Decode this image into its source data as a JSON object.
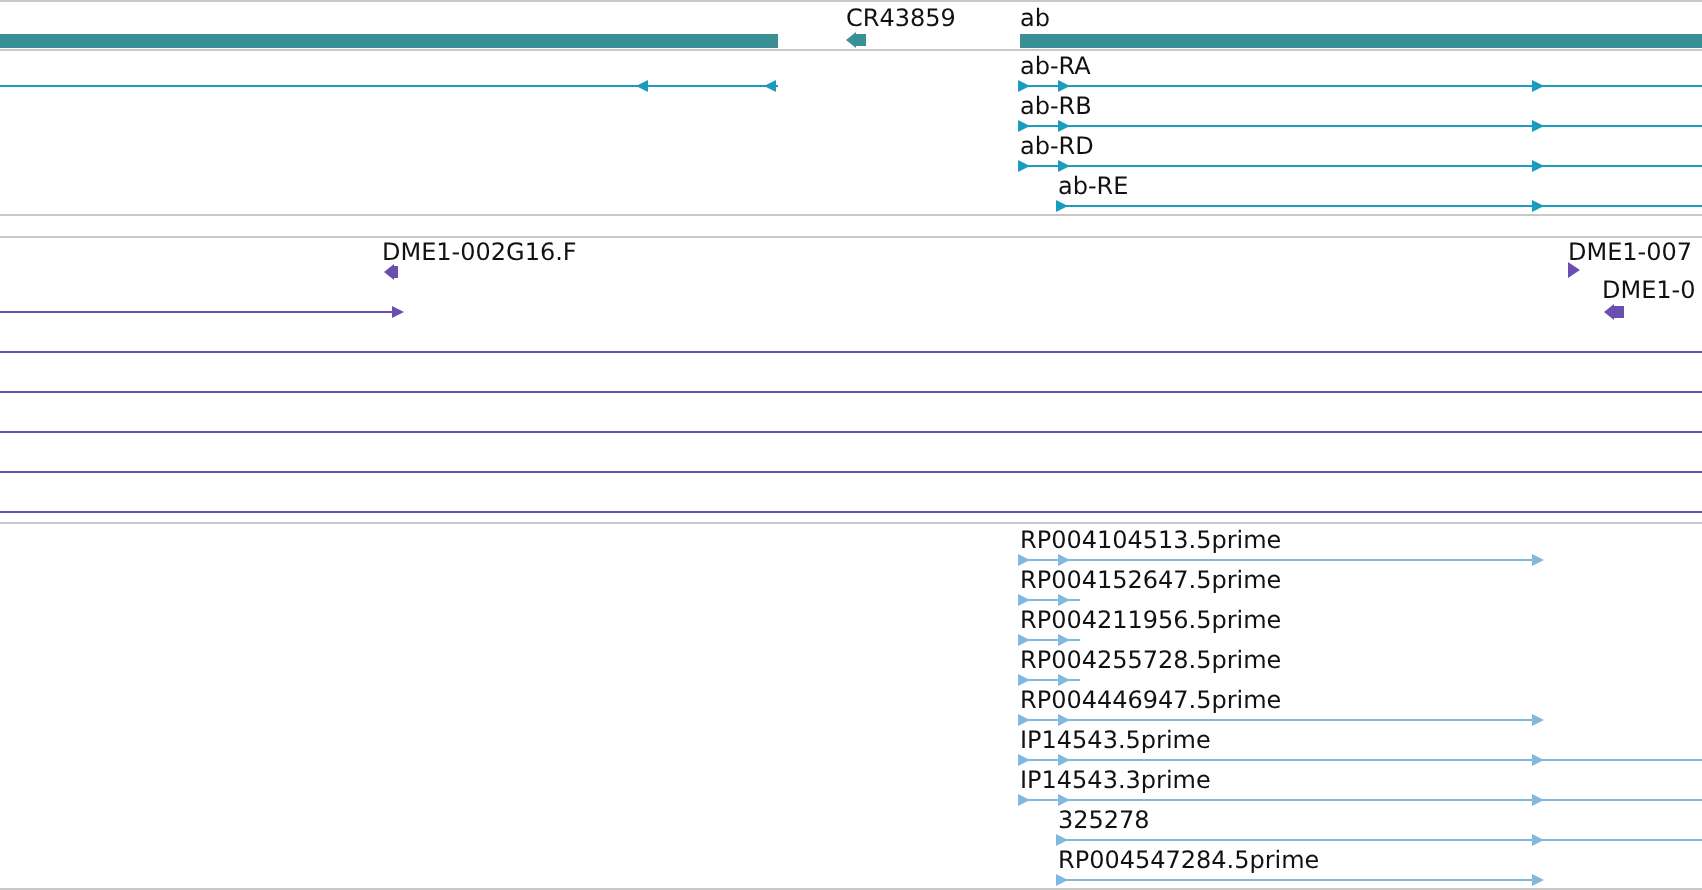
{
  "tracks": [
    {
      "kind": "genes",
      "color": "#1a9cc0",
      "features": [
        {
          "kind": "bar"
        },
        {
          "kind": "stub",
          "label": "CR43859",
          "reverse": true
        },
        {
          "kind": "bar",
          "label": "ab"
        },
        {
          "kind": "line",
          "reverse": true
        },
        {
          "kind": "line",
          "label": "ab-RA",
          "reverse": false
        },
        {
          "kind": "line",
          "label": "ab-RB",
          "reverse": false
        },
        {
          "kind": "line",
          "label": "ab-RD",
          "reverse": false
        },
        {
          "kind": "line",
          "label": "ab-RE",
          "reverse": false
        }
      ]
    },
    {
      "kind": "clones",
      "color": "#6a4fb0",
      "features": [
        {
          "kind": "stub",
          "label": "DME1-002G16.F",
          "reverse": true
        },
        {
          "kind": "line",
          "reverse": false
        },
        {
          "kind": "stub",
          "label": "DME1-007",
          "reverse": false
        },
        {
          "kind": "stub",
          "label": "DME1-0",
          "reverse": true
        },
        {
          "kind": "line"
        },
        {
          "kind": "line"
        },
        {
          "kind": "line"
        },
        {
          "kind": "line"
        },
        {
          "kind": "line"
        }
      ]
    },
    {
      "kind": "reads",
      "color": "#80b8e0",
      "features": [
        {
          "kind": "line",
          "label": "RP004104513.5prime",
          "reverse": false
        },
        {
          "kind": "line",
          "label": "RP004152647.5prime",
          "reverse": false
        },
        {
          "kind": "line",
          "label": "RP004211956.5prime",
          "reverse": false
        },
        {
          "kind": "line",
          "label": "RP004255728.5prime",
          "reverse": false
        },
        {
          "kind": "line",
          "label": "RP004446947.5prime",
          "reverse": false
        },
        {
          "kind": "line",
          "label": "IP14543.5prime",
          "reverse": false
        },
        {
          "kind": "line",
          "label": "IP14543.3prime",
          "reverse": false
        },
        {
          "kind": "line",
          "label": "325278",
          "reverse": false
        },
        {
          "kind": "line",
          "label": "RP004547284.5prime",
          "reverse": false
        }
      ]
    }
  ]
}
